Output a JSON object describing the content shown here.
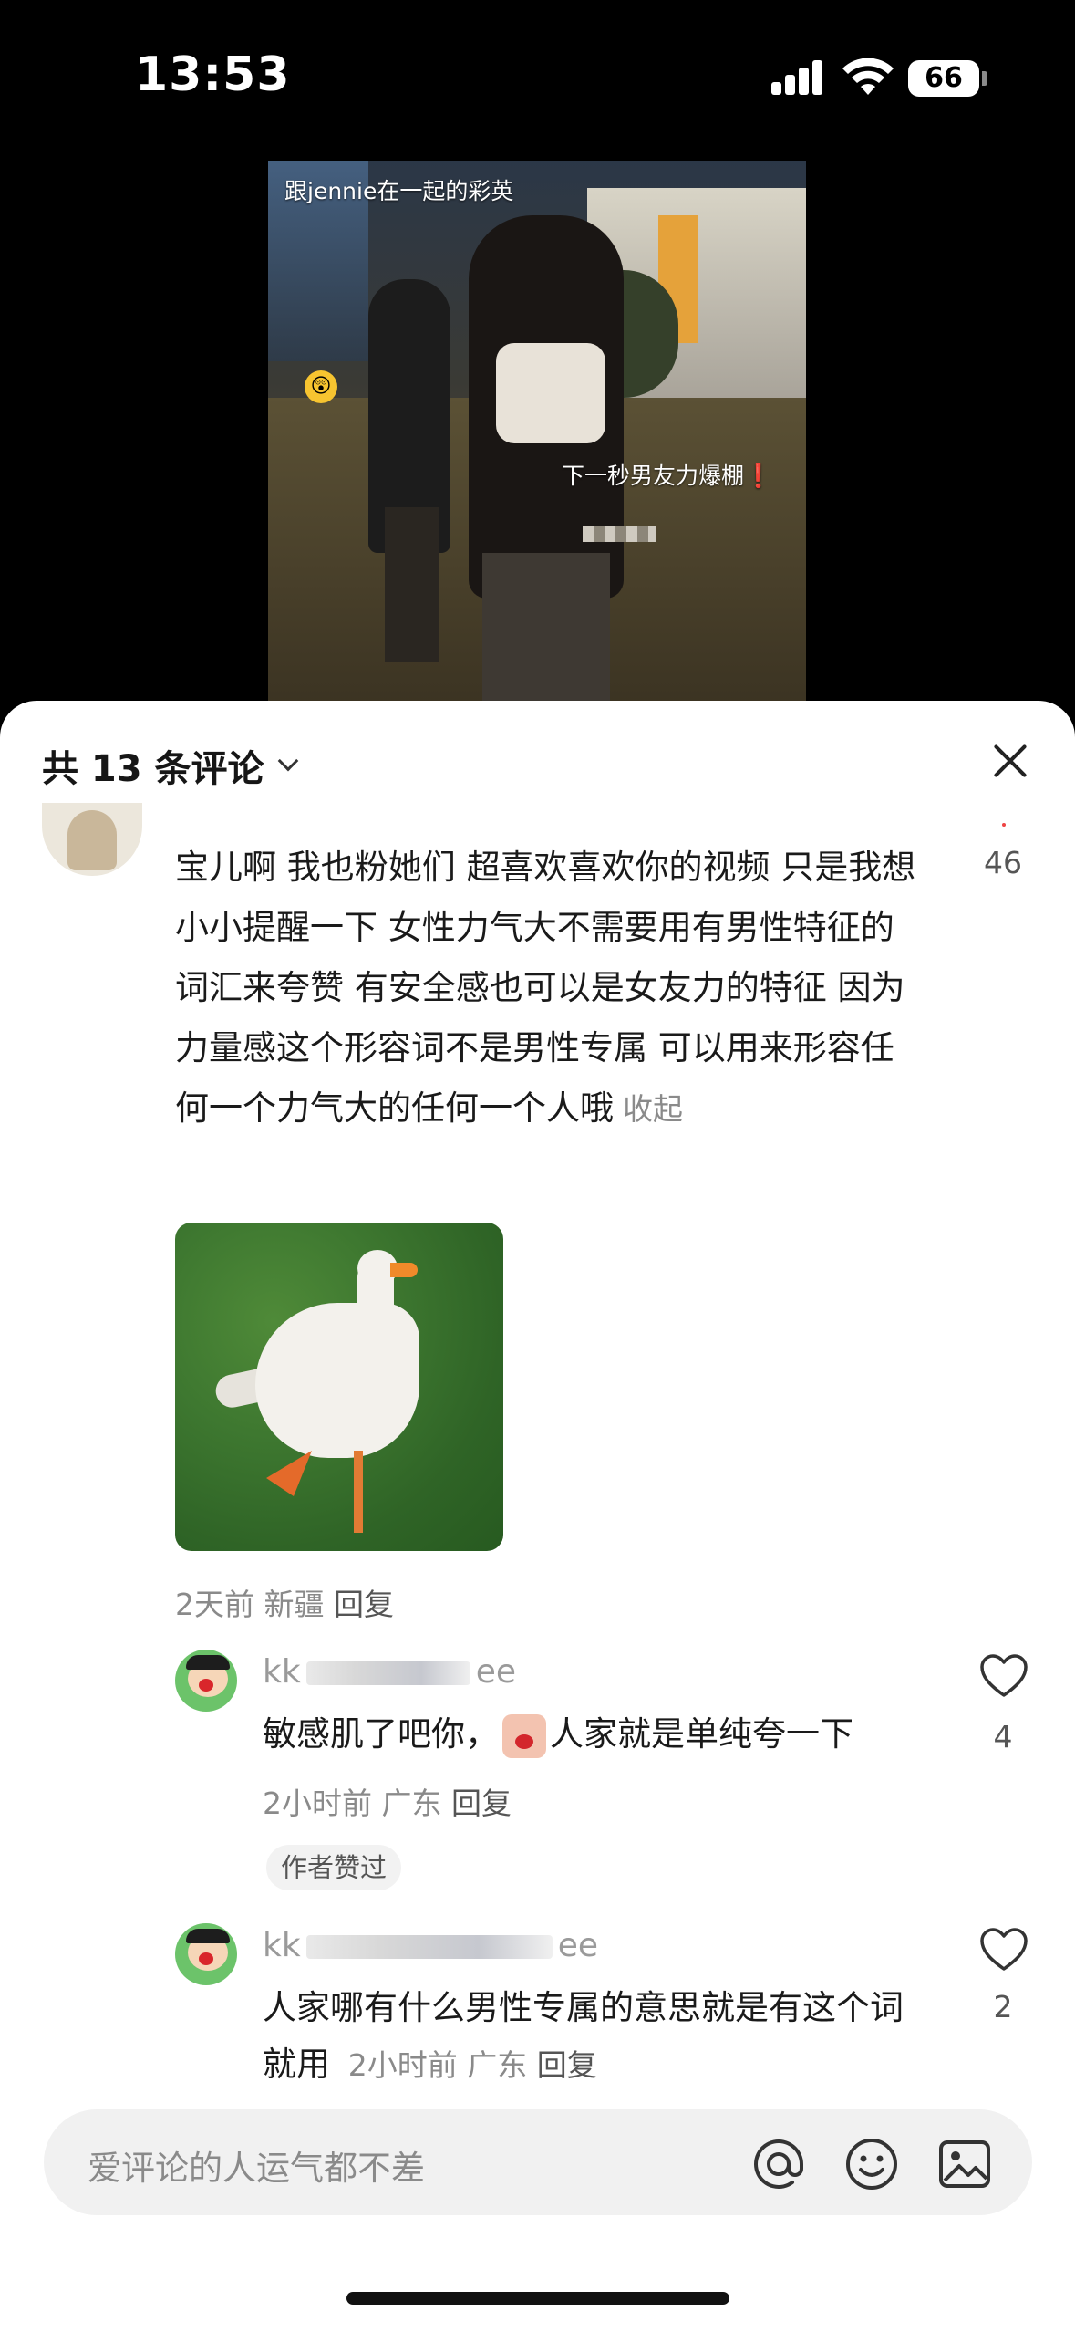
{
  "status_bar": {
    "time": "13:53",
    "battery": "66"
  },
  "video": {
    "caption_top": "跟jennie在一起的彩英",
    "caption_mid": "下一秒男友力爆棚❗"
  },
  "sheet": {
    "title": "共 13 条评论",
    "close_icon": "close-icon"
  },
  "comments": [
    {
      "text": "宝儿啊 我也粉她们 超喜欢喜欢你的视频 只是我想小小提醒一下 女性力气大不需要用有男性特征的词汇来夸赞 有安全感也可以是女友力的特征 因为力量感这个形容词不是男性专属 可以用来形容任何一个力气大的任何一个人哦",
      "collapse_label": "收起",
      "likes": "46",
      "time": "2天前",
      "location": "新疆",
      "reply_label": "回复",
      "image_alt": "goose"
    }
  ],
  "replies": [
    {
      "username_start": "kk",
      "username_end": "ee",
      "text_before_emoji": "敏感肌了吧你，",
      "text_after_emoji": "人家就是单纯夸一下",
      "likes": "4",
      "time": "2小时前",
      "location": "广东",
      "reply_label": "回复",
      "badge": "作者赞过"
    },
    {
      "username_start": "kk",
      "username_end": "ee",
      "text": "人家哪有什么男性专属的意思就是有这个词就用",
      "likes": "2",
      "time": "2小时前",
      "location": "广东",
      "reply_label": "回复"
    }
  ],
  "input": {
    "placeholder": "爱评论的人运气都不差",
    "icons": [
      "at-icon",
      "emoji-icon",
      "image-icon"
    ]
  }
}
